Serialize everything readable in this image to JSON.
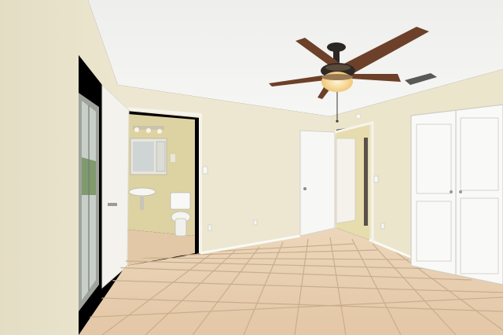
{
  "scene": {
    "kind": "photo-interior",
    "room": "empty bedroom",
    "features": [
      "ceiling-fan",
      "bathroom-doorway",
      "sliding-glass-door",
      "closet-double-door",
      "hallway-door",
      "tile-floor"
    ]
  },
  "colors": {
    "ceiling": "#f2f2f0",
    "wall": "#ede8d4",
    "wall_shadow": "#d8d2ba",
    "floor": "#e6cdae",
    "floor_grout": "#c4a888",
    "door_white": "#f6f6f4",
    "bath_wall": "#ddd3a6",
    "fan_blade": "#6b4028",
    "fan_body": "#2a2622",
    "light_glow": "#f4d9a0"
  }
}
